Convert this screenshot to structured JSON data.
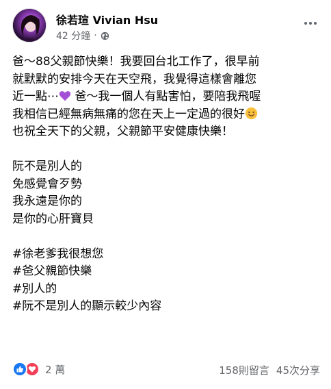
{
  "post": {
    "author": "徐若瑄 Vivian Hsu",
    "time": "42 分鐘",
    "dot": "·",
    "privacy_icon": "globe-icon",
    "more_icon": "more-icon",
    "lines": [
      "爸～88父親節快樂！我要回台北工作了，很早前",
      "就默默的安排今天在天空飛，我覺得這樣會離您",
      "近一點⋯",
      " 爸～我一個人有點害怕，要陪我飛喔",
      "我相信已經無病無痛的您在天上一定過的很好",
      "也祝全天下的父親，父親節平安健康快樂！"
    ],
    "poem": [
      "阮不是別人的",
      "免感覺會歹勢",
      "我永遠是你的",
      "是你的心肝寶貝"
    ],
    "hashtags": [
      "#徐老爹我很想您",
      "#爸父親節快樂",
      "#別人的",
      "#阮不是別人的顯示較少內容"
    ]
  },
  "footer": {
    "reaction_count": "2 萬",
    "comments": "158則留言",
    "shares": "45次分享"
  },
  "colors": {
    "like_blue": "#1877f2",
    "love_red": "#f33e58",
    "purple_heart": "#a34fd6",
    "smiley_yellow": "#f7c13a",
    "secondary_text": "#65676b"
  }
}
